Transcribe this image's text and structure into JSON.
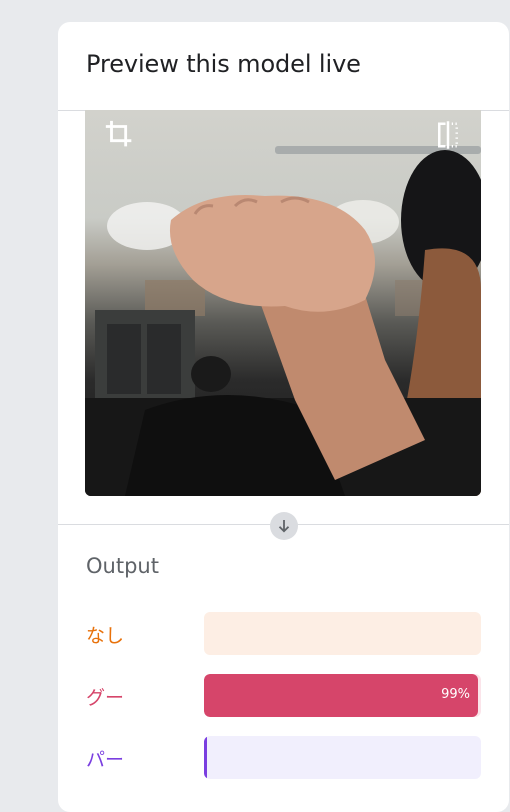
{
  "panel": {
    "title": "Preview this model live"
  },
  "preview": {
    "crop_icon": "crop-icon",
    "flip_icon": "flip-horizontal-icon",
    "expand_icon": "arrow-down-icon"
  },
  "output": {
    "title": "Output",
    "classes": [
      {
        "label": "なし",
        "confidence_percent": 0,
        "percent_text": "",
        "color": "#e8710a",
        "track_color": "#fdeee4"
      },
      {
        "label": "グー",
        "confidence_percent": 99,
        "percent_text": "99%",
        "color": "#d6456a",
        "track_color": "#fbe4ea"
      },
      {
        "label": "パー",
        "confidence_percent": 1,
        "percent_text": "",
        "color": "#7a3ee0",
        "track_color": "#f1effd"
      }
    ]
  }
}
